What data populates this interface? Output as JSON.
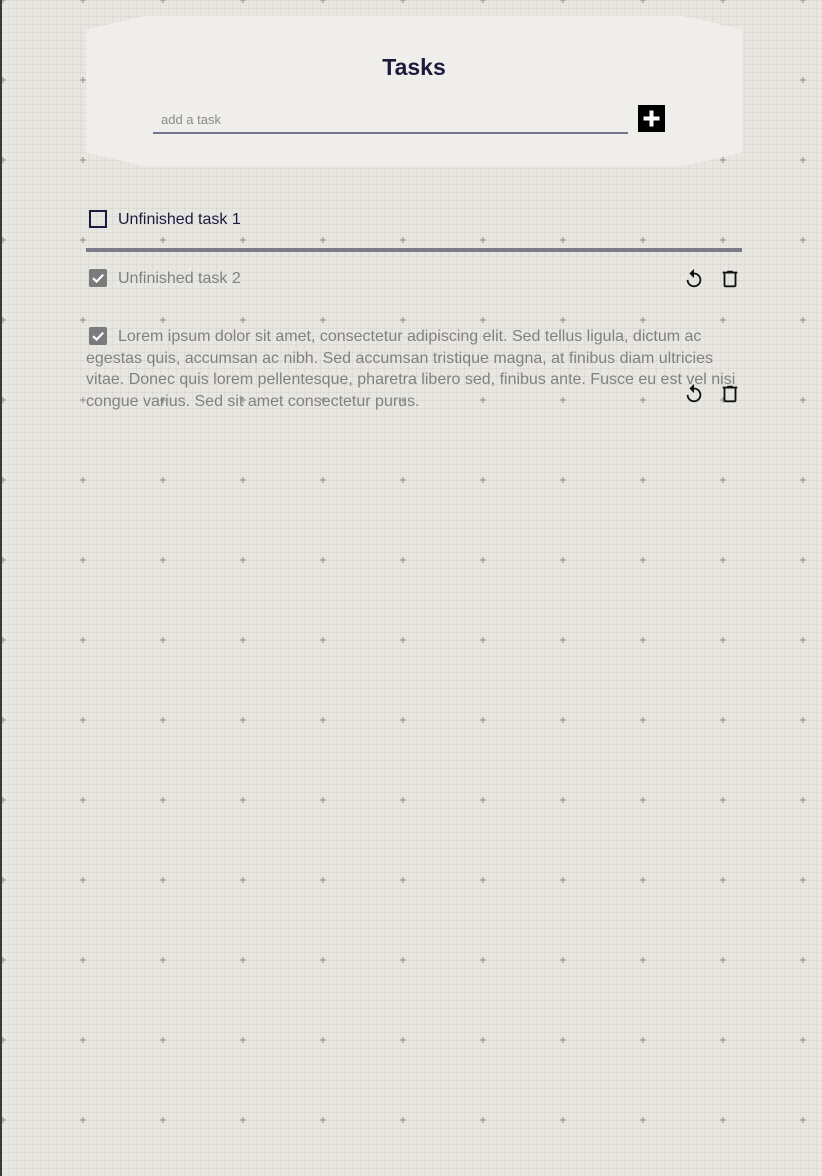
{
  "header": {
    "title": "Tasks",
    "input_placeholder": "add a task",
    "input_value": "",
    "add_icon": "plus-icon"
  },
  "tasks": [
    {
      "label": "Unfinished task 1",
      "done": false
    },
    {
      "label": "Unfinished task 2",
      "done": true
    },
    {
      "label": "Lorem ipsum dolor sit amet, consectetur adipiscing elit. Sed tellus ligula, dictum ac egestas quis, accumsan ac nibh. Sed accumsan tristique magna, at finibus diam ultricies vitae. Donec quis lorem pellentesque, pharetra libero sed, finibus ante. Fusce eu est vel nisi congue varius. Sed sit amet consectetur purus.",
      "done": true
    }
  ],
  "icons": {
    "checkbox_checked": "checkmark-icon",
    "restore": "undo-icon",
    "delete": "trash-icon"
  },
  "colors": {
    "title": "#1c1a3d",
    "divider": "#7d7a8c",
    "done_text": "#808080",
    "checked_box": "#7b7b7b",
    "background": "#e8e6e1",
    "card": "#f0eeea"
  }
}
